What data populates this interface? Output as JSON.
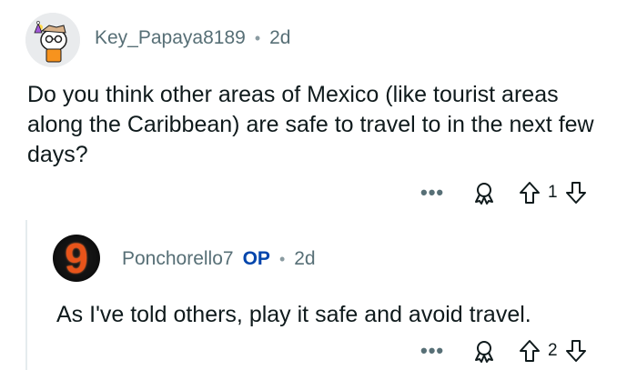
{
  "comments": [
    {
      "username": "Key_Papaya8189",
      "separator": "•",
      "age": "2d",
      "body": "Do you think other areas of Mexico (like tourist areas along the Caribbean) are safe to travel to in the next few days?",
      "more_label": "•••",
      "vote_count": "1"
    },
    {
      "username": "Ponchorello7",
      "op_badge": "OP",
      "separator": "•",
      "age": "2d",
      "body": "As I've told others, play it safe and avoid travel.",
      "avatar_glyph": "9",
      "more_label": "•••",
      "vote_count": "2"
    }
  ],
  "icons": {
    "award": "award-icon",
    "upvote": "upvote-arrow-icon",
    "downvote": "downvote-arrow-icon"
  },
  "colors": {
    "meta_text": "#576f76",
    "op_badge": "#0045ac",
    "thread_line": "#e5ebee"
  }
}
